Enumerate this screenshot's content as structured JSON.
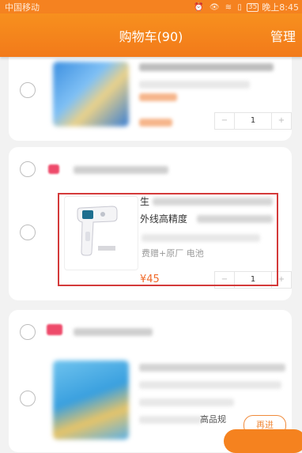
{
  "status_bar": {
    "carrier": "中国移动",
    "icons": "⏰ 👁 ≋ ▯",
    "battery": "35",
    "time": "晚上8:45"
  },
  "nav": {
    "title": "购物车(90)",
    "action": "管理"
  },
  "focused_item": {
    "title_line1": "生",
    "title_line2": "外线高精度",
    "spec": "费赠+原厂 电池",
    "price": "¥45",
    "quantity": "1",
    "minus": "−",
    "plus": "+"
  },
  "item_top": {
    "quantity": "1",
    "minus": "−",
    "plus": "+"
  },
  "item_bottom": {
    "title_fragment": "高品规",
    "action_button": "再进"
  }
}
